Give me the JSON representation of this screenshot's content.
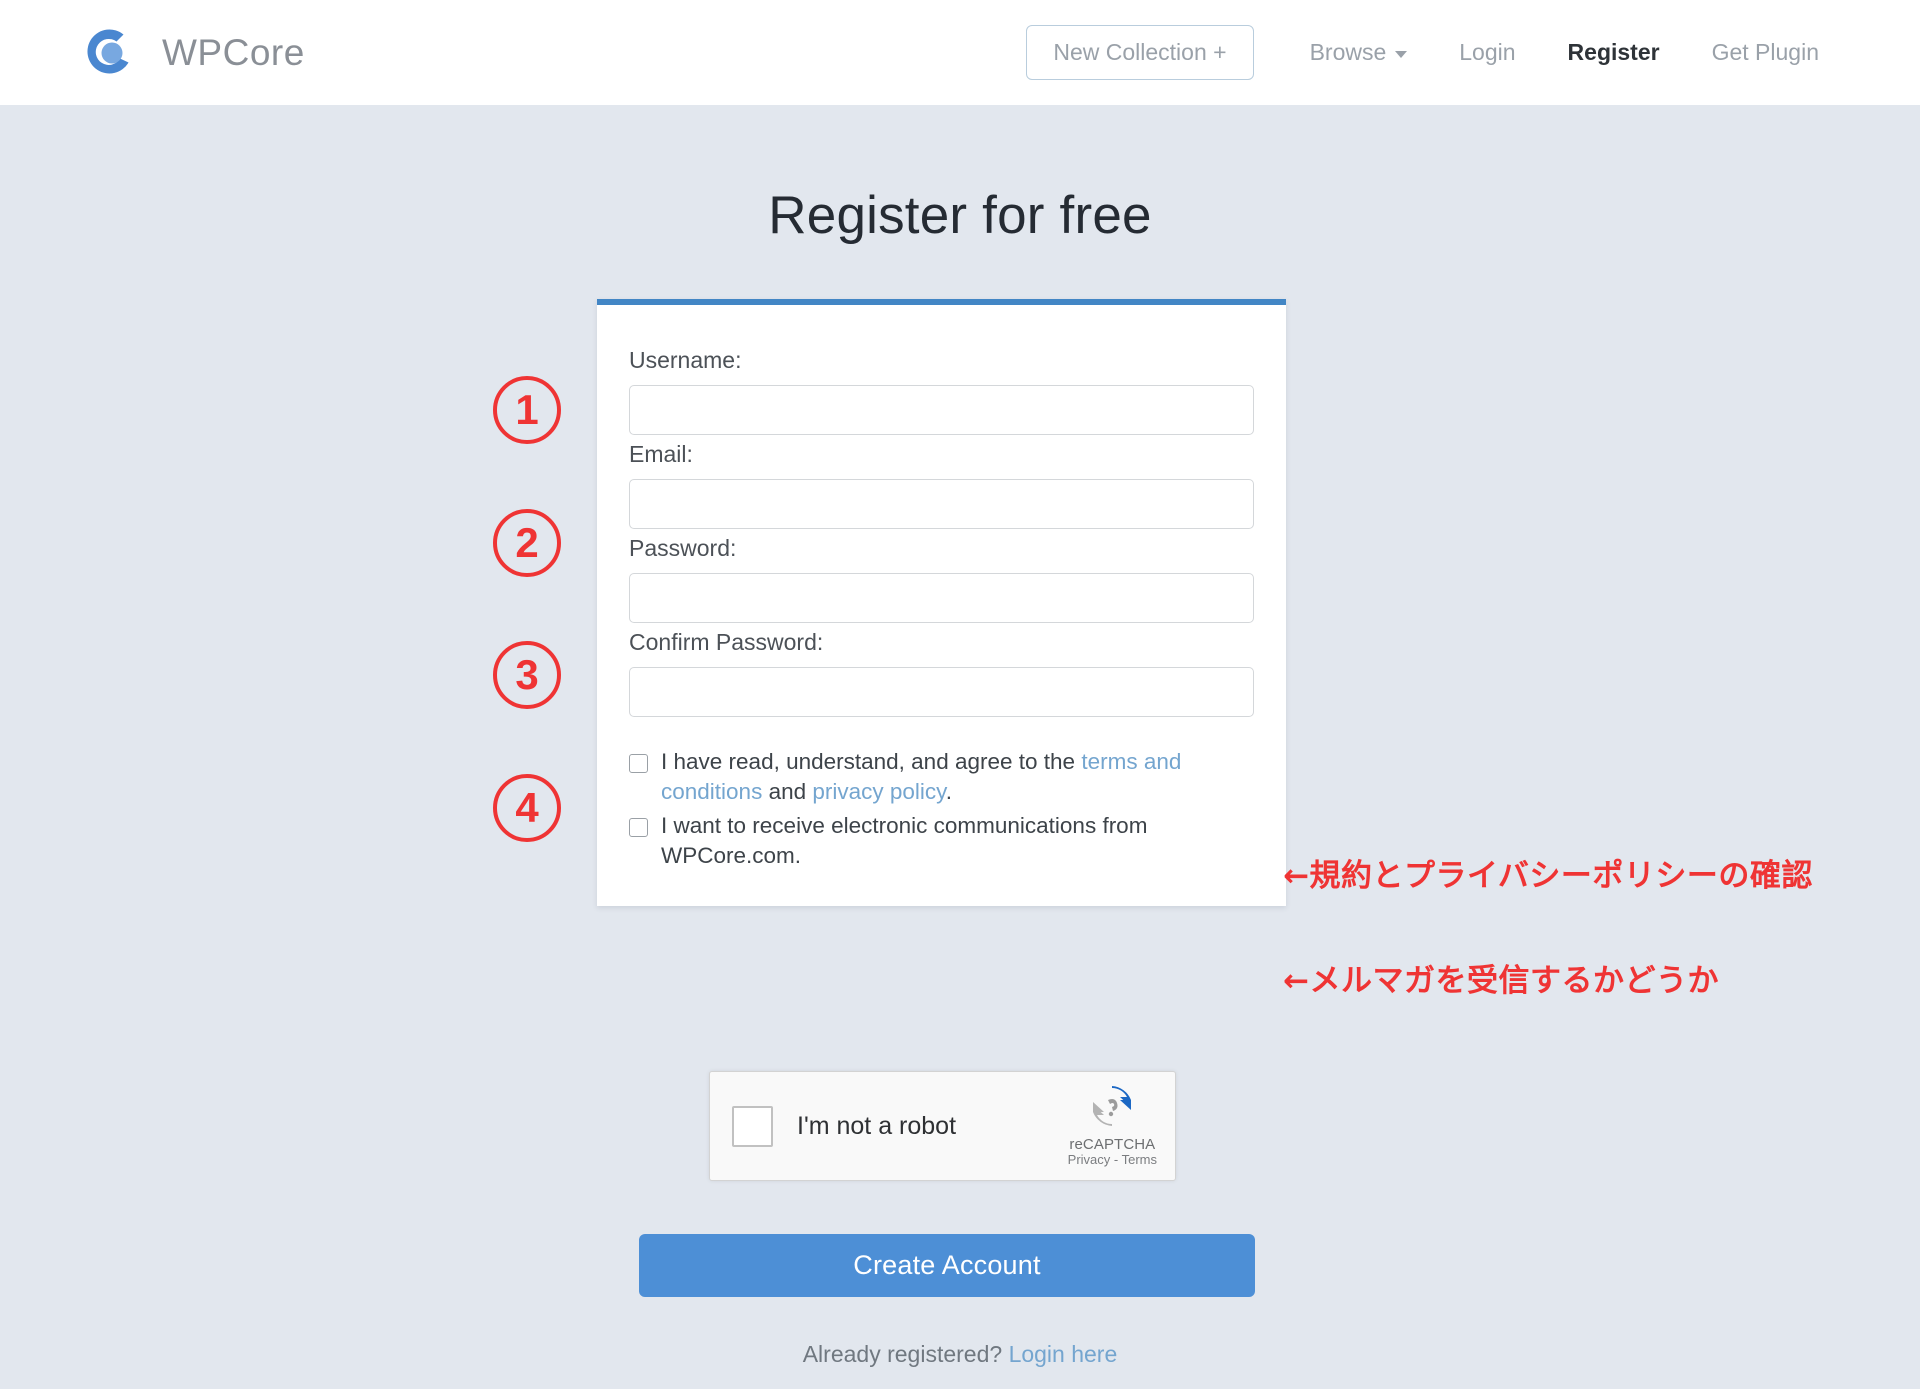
{
  "header": {
    "brand_name": "WPCore",
    "logo_icon": "wpcore-ring-logo-icon",
    "new_collection_label": "New Collection +",
    "nav_items": [
      {
        "label": "Browse",
        "icon": "chevron-down-icon",
        "active": false
      },
      {
        "label": "Login",
        "active": false
      },
      {
        "label": "Register",
        "active": true
      },
      {
        "label": "Get Plugin",
        "active": false
      }
    ]
  },
  "page": {
    "title": "Register for free"
  },
  "form": {
    "fields": [
      {
        "label": "Username:",
        "value": "",
        "placeholder": ""
      },
      {
        "label": "Email:",
        "value": "",
        "placeholder": ""
      },
      {
        "label": "Password:",
        "value": "",
        "placeholder": ""
      },
      {
        "label": "Confirm Password:",
        "value": "",
        "placeholder": ""
      }
    ],
    "consents": [
      {
        "checked": false,
        "text_before": "I have read, understand, and agree to the ",
        "link1": "terms and conditions",
        "text_middle": " and ",
        "link2": "privacy policy",
        "text_after": "."
      },
      {
        "checked": false,
        "text_before": "I want to receive electronic communications from WPCore.com.",
        "link1": "",
        "text_middle": "",
        "link2": "",
        "text_after": ""
      }
    ],
    "submit_label": "Create Account"
  },
  "recaptcha": {
    "label": "I'm not a robot",
    "brand": "reCAPTCHA",
    "legal": "Privacy - Terms",
    "logo_icon": "recaptcha-arrows-icon",
    "checked": false
  },
  "footer": {
    "prompt_text": "Already registered? ",
    "login_link": "Login here"
  },
  "annotations": {
    "numbers": [
      "1",
      "2",
      "3",
      "4"
    ],
    "note_terms": "←規約とプライバシーポリシーの確認",
    "note_newsletter": "←メルマガを受信するかどうか"
  },
  "colors": {
    "page_background": "#e2e7ee",
    "card_top_border": "#4286c5",
    "primary_button": "#4d8fd6",
    "link": "#74a5cf",
    "annotation_red": "#ef3434",
    "brand_blue": "#4a87d0"
  }
}
